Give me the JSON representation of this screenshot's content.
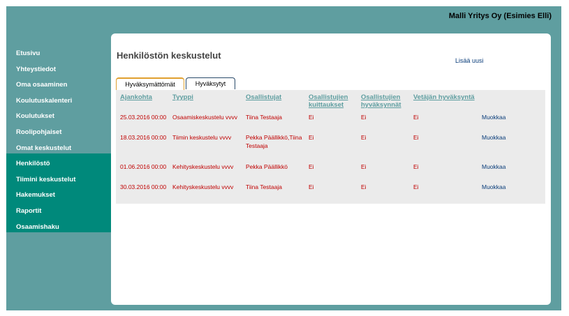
{
  "header": {
    "user_label": "Malli Yritys Oy (Esimies Elli)"
  },
  "sidebar": {
    "items": [
      {
        "label": "Etusivu"
      },
      {
        "label": "Yhteystiedot"
      },
      {
        "label": "Oma osaaminen"
      },
      {
        "label": "Koulutuskalenteri"
      },
      {
        "label": "Koulutukset"
      },
      {
        "label": "Roolipohjaiset"
      },
      {
        "label": "Omat keskustelut"
      },
      {
        "label": "Henkilöstö"
      },
      {
        "label": "Tiimini keskustelut"
      },
      {
        "label": "Hakemukset"
      },
      {
        "label": "Raportit"
      },
      {
        "label": "Osaamishaku"
      }
    ],
    "active_item": "Henkilöstö"
  },
  "main": {
    "title": "Henkilöstön keskustelut",
    "add_link": "Lisää uusi",
    "tabs": [
      {
        "label": "Hyväksymättömät",
        "active": true
      },
      {
        "label": "Hyväksytyt",
        "active": false
      }
    ],
    "table": {
      "columns": [
        "Ajankohta",
        "Tyyppi",
        "Osallistujat",
        "Osallistujien kuittaukset",
        "Osallistujien hyväksynnät",
        "Vetäjän hyväksyntä"
      ],
      "rows": [
        {
          "date": "25.03.2016 00:00",
          "type": "Osaamiskeskustelu vvvv",
          "participants": "Tiina Testaaja",
          "acks": "Ei",
          "approvals": "Ei",
          "leader": "Ei",
          "action": "Muokkaa"
        },
        {
          "date": "18.03.2016 00:00",
          "type": "Tiimin keskustelu vvvv",
          "participants": "Pekka Päällikkö,Tiina Testaaja",
          "acks": "Ei",
          "approvals": "Ei",
          "leader": "Ei",
          "action": "Muokkaa"
        },
        {
          "date": "01.06.2016 00:00",
          "type": "Kehityskeskustelu vvvv",
          "participants": "Pekka Päällikkö",
          "acks": "Ei",
          "approvals": "Ei",
          "leader": "Ei",
          "action": "Muokkaa"
        },
        {
          "date": "30.03.2016 00:00",
          "type": "Kehityskeskustelu vvvv",
          "participants": "Tiina Testaaja",
          "acks": "Ei",
          "approvals": "Ei",
          "leader": "Ei",
          "action": "Muokkaa"
        }
      ]
    }
  },
  "colors": {
    "background": "#5f9ea0",
    "sidebar_active": "#00897b",
    "header_link": "#5f9ea0",
    "cell_text": "#c00000",
    "action_link": "#0a3d7a",
    "active_tab_border": "#e0a030"
  }
}
